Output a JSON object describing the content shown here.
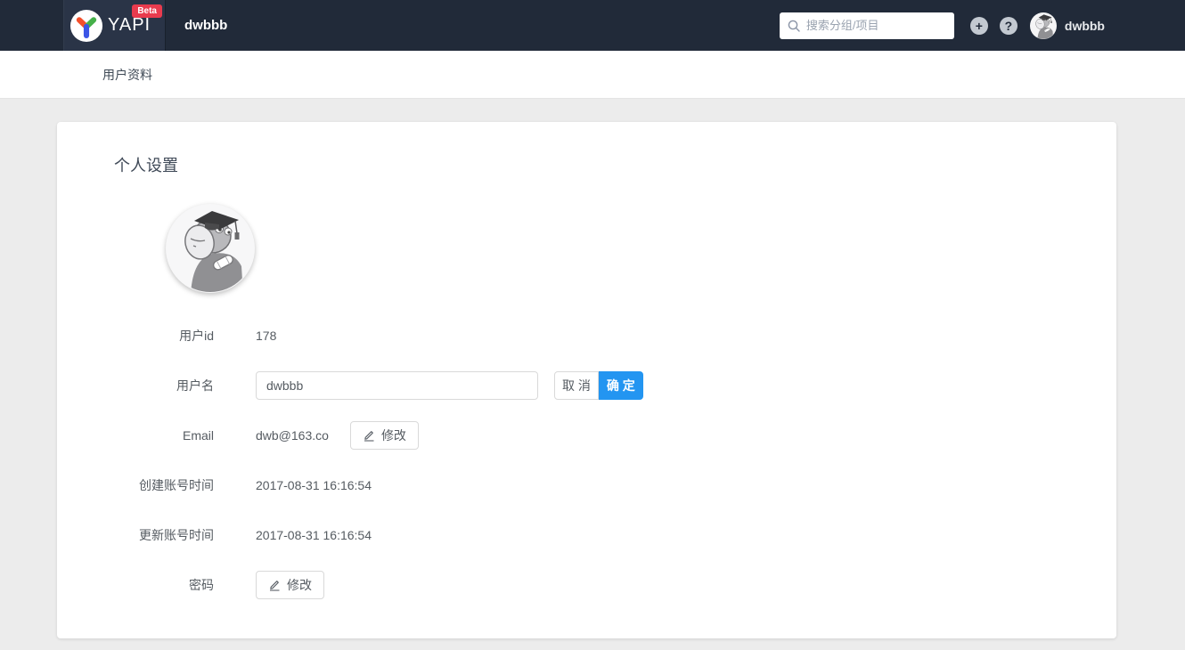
{
  "navbar": {
    "logo_text": "YAPI",
    "beta_label": "Beta",
    "title": "dwbbb",
    "search_placeholder": "搜索分组/项目",
    "add_label": "+",
    "help_label": "?",
    "username": "dwbbb"
  },
  "subheader": {
    "title": "用户资料"
  },
  "profile": {
    "heading": "个人设置",
    "rows": {
      "user_id": {
        "label": "用户id",
        "value": "178"
      },
      "username": {
        "label": "用户名",
        "value": "dwbbb",
        "cancel_label": "取 消",
        "confirm_label": "确 定"
      },
      "email": {
        "label": "Email",
        "value": "dwb@163.co",
        "edit_label": "修改"
      },
      "created_at": {
        "label": "创建账号时间",
        "value": "2017-08-31 16:16:54"
      },
      "updated_at": {
        "label": "更新账号时间",
        "value": "2017-08-31 16:16:54"
      },
      "password": {
        "label": "密码",
        "edit_label": "修改"
      }
    }
  },
  "icons": {
    "search_icon": "magnifier",
    "add_icon": "plus-circle",
    "help_icon": "question-circle",
    "edit_icon": "pencil",
    "logo_icon": "yapi-y"
  },
  "colors": {
    "primary_blue": "#2395f1",
    "navbar_bg": "#212a39",
    "logo_block_bg": "#2a3447",
    "beta_red": "#e93b4e",
    "page_bg": "#ececec"
  }
}
